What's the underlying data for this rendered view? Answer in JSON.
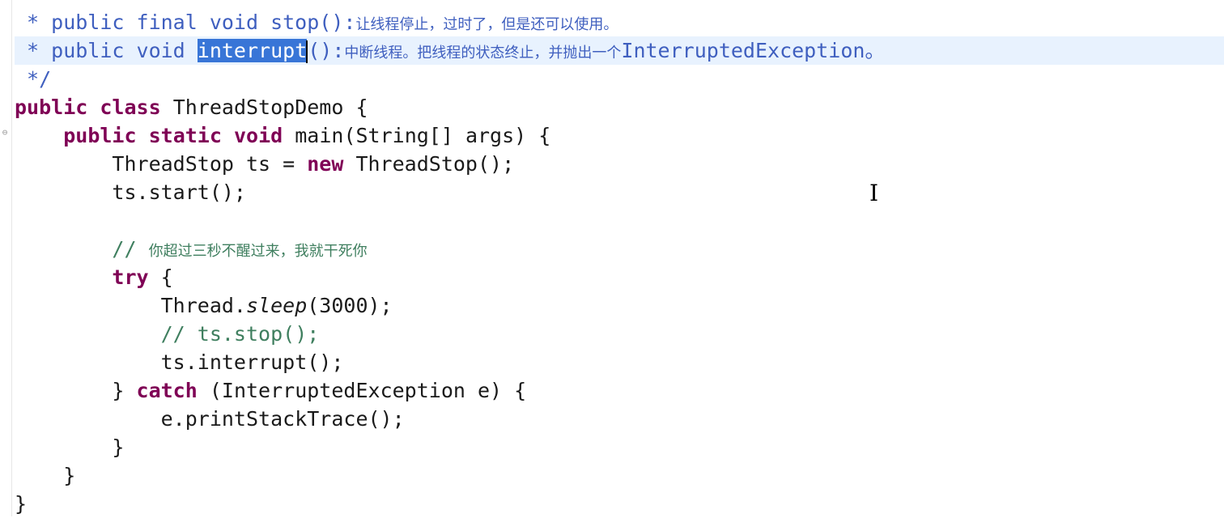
{
  "editor": {
    "javadoc_line1": {
      "prefix": " * public final void stop():",
      "desc": "让线程停止，过时了，但是还可以使用。"
    },
    "javadoc_line2": {
      "star": " * public void ",
      "selected": "interrupt",
      "parens": "():",
      "desc": "中断线程。把线程的状态终止，并抛出一个",
      "suffix": "InterruptedException。"
    },
    "javadoc_end": " */",
    "class_decl": {
      "kw1": "public",
      "kw2": "class",
      "rest": " ThreadStopDemo {"
    },
    "main_decl": {
      "kw1": "public",
      "kw2": "static",
      "kw3": "void",
      "rest": " main(String[] args) {"
    },
    "line_new": {
      "a": "ThreadStop ts = ",
      "kw": "new",
      "b": " ThreadStop();"
    },
    "line_start": "ts.start();",
    "line_comment": {
      "slashes": "// ",
      "text": "你超过三秒不醒过来，我就干死你"
    },
    "line_try": {
      "kw": "try",
      "rest": " {"
    },
    "line_sleep": {
      "a": "Thread.",
      "method": "sleep",
      "b": "(3000);"
    },
    "line_stop_comment": "// ts.stop();",
    "line_interrupt": "ts.interrupt();",
    "line_catch": {
      "a": "} ",
      "kw": "catch",
      "b": " (InterruptedException e) {"
    },
    "line_print": "e.printStackTrace();",
    "close_catch": "}",
    "close_main": "}",
    "close_class": "}"
  },
  "colors": {
    "keyword": "#7f0055",
    "comment": "#3f7f5f",
    "javadoc": "#3f5fbf",
    "selection": "#3875d7",
    "current_line": "#e8f2fe"
  }
}
